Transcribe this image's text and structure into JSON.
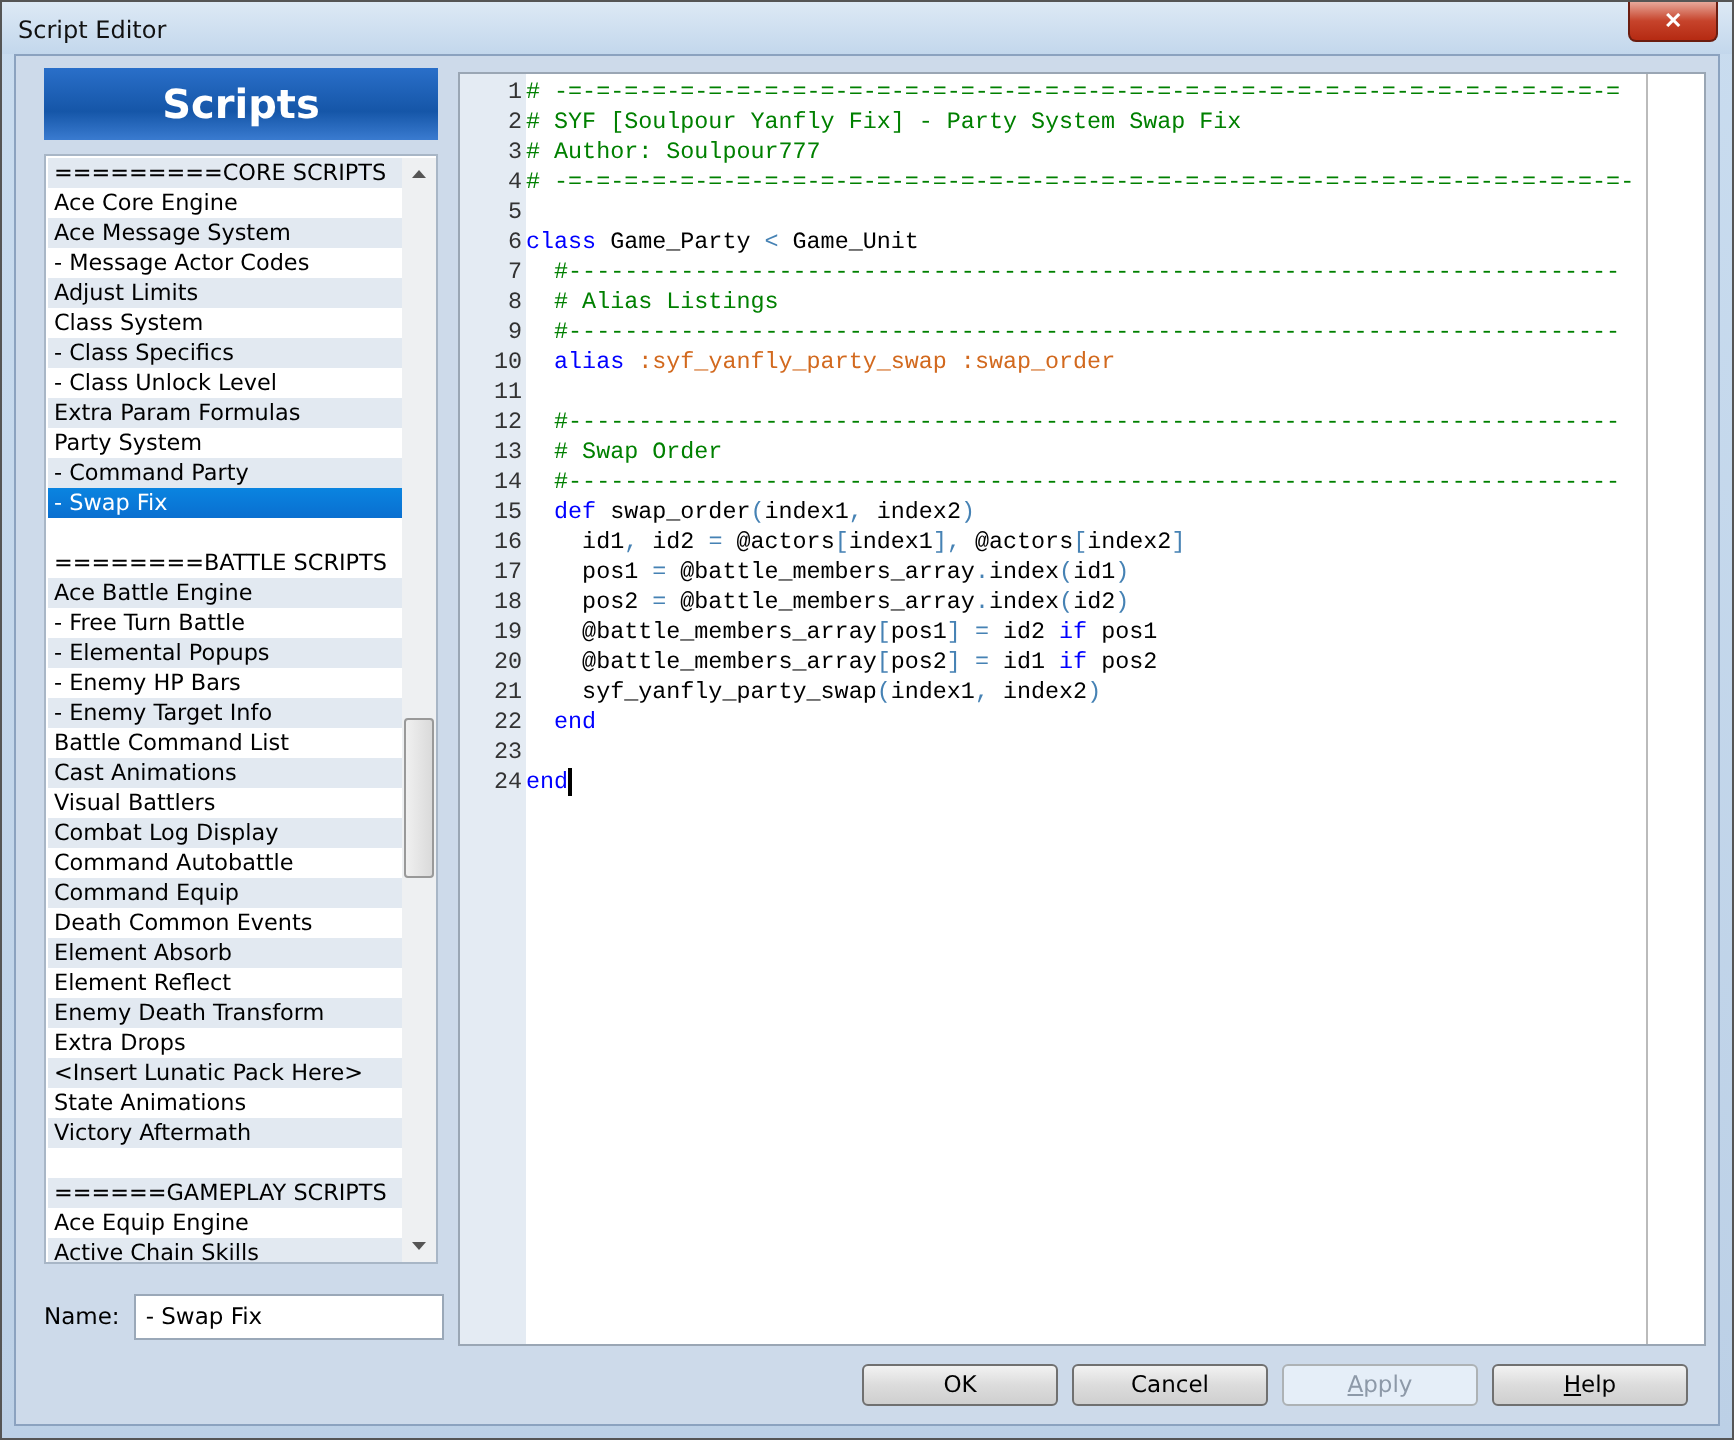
{
  "window": {
    "title": "Script Editor",
    "close_label": "✕"
  },
  "sidebar": {
    "title": "Scripts",
    "items": [
      {
        "kind": "item",
        "label": "=========CORE SCRIPTS",
        "selected": false
      },
      {
        "kind": "item",
        "label": "Ace Core Engine",
        "selected": false
      },
      {
        "kind": "item",
        "label": "Ace Message System",
        "selected": false
      },
      {
        "kind": "item",
        "label": "- Message Actor Codes",
        "selected": false
      },
      {
        "kind": "item",
        "label": "Adjust Limits",
        "selected": false
      },
      {
        "kind": "item",
        "label": "Class System",
        "selected": false
      },
      {
        "kind": "item",
        "label": "- Class Specifics",
        "selected": false
      },
      {
        "kind": "item",
        "label": "- Class Unlock Level",
        "selected": false
      },
      {
        "kind": "item",
        "label": "Extra Param Formulas",
        "selected": false
      },
      {
        "kind": "item",
        "label": "Party System",
        "selected": false
      },
      {
        "kind": "item",
        "label": "- Command Party",
        "selected": false
      },
      {
        "kind": "item",
        "label": "- Swap Fix",
        "selected": true
      },
      {
        "kind": "blank",
        "selected": false
      },
      {
        "kind": "item",
        "label": "========BATTLE SCRIPTS",
        "selected": false
      },
      {
        "kind": "item",
        "label": "Ace Battle Engine",
        "selected": false
      },
      {
        "kind": "item",
        "label": "- Free Turn Battle",
        "selected": false
      },
      {
        "kind": "item",
        "label": "- Elemental Popups",
        "selected": false
      },
      {
        "kind": "item",
        "label": "- Enemy HP Bars",
        "selected": false
      },
      {
        "kind": "item",
        "label": "- Enemy Target Info",
        "selected": false
      },
      {
        "kind": "item",
        "label": "Battle Command List",
        "selected": false
      },
      {
        "kind": "item",
        "label": "Cast Animations",
        "selected": false
      },
      {
        "kind": "item",
        "label": "Visual Battlers",
        "selected": false
      },
      {
        "kind": "item",
        "label": "Combat Log Display",
        "selected": false
      },
      {
        "kind": "item",
        "label": "Command Autobattle",
        "selected": false
      },
      {
        "kind": "item",
        "label": "Command Equip",
        "selected": false
      },
      {
        "kind": "item",
        "label": "Death Common Events",
        "selected": false
      },
      {
        "kind": "item",
        "label": "Element Absorb",
        "selected": false
      },
      {
        "kind": "item",
        "label": "Element Reflect",
        "selected": false
      },
      {
        "kind": "item",
        "label": "Enemy Death Transform",
        "selected": false
      },
      {
        "kind": "item",
        "label": "Extra Drops",
        "selected": false
      },
      {
        "kind": "item",
        "label": "<Insert Lunatic Pack Here>",
        "selected": false
      },
      {
        "kind": "item",
        "label": "State Animations",
        "selected": false
      },
      {
        "kind": "item",
        "label": "Victory Aftermath",
        "selected": false
      },
      {
        "kind": "blank",
        "selected": false
      },
      {
        "kind": "item",
        "label": "======GAMEPLAY SCRIPTS",
        "selected": false
      },
      {
        "kind": "item",
        "label": "Ace Equip Engine",
        "selected": false
      },
      {
        "kind": "item",
        "label": "Active Chain Skills",
        "selected": false
      }
    ]
  },
  "name_field": {
    "label": "Name:",
    "value": "- Swap Fix"
  },
  "editor": {
    "lines": [
      {
        "number": "1",
        "tokens": [
          {
            "kind": "comment",
            "text": "# -=-=-=-=-=-=-=-=-=-=-=-=-=-=-=-=-=-=-=-=-=-=-=-=-=-=-=-=-=-=-=-=-=-=-=-=-=-="
          }
        ]
      },
      {
        "number": "2",
        "tokens": [
          {
            "kind": "comment",
            "text": "# SYF [Soulpour Yanfly Fix] - Party System Swap Fix"
          }
        ]
      },
      {
        "number": "3",
        "tokens": [
          {
            "kind": "comment",
            "text": "# Author: Soulpour777"
          }
        ]
      },
      {
        "number": "4",
        "tokens": [
          {
            "kind": "comment",
            "text": "# -=-=-=-=-=-=-=-=-=-=-=-=-=-=-=-=-=-=-=-=-=-=-=-=-=-=-=-=-=-=-=-=-=-=-=-=-=-=-"
          }
        ]
      },
      {
        "number": "5"
      },
      {
        "number": "6",
        "tokens": [
          {
            "kind": "keyword",
            "text": "class"
          },
          {
            "kind": "plain",
            "text": " Game_Party "
          },
          {
            "kind": "punct",
            "text": "<"
          },
          {
            "kind": "plain",
            "text": " Game_Unit"
          }
        ]
      },
      {
        "number": "7",
        "tokens": [
          {
            "kind": "comment",
            "text": "  #---------------------------------------------------------------------------"
          }
        ]
      },
      {
        "number": "8",
        "tokens": [
          {
            "kind": "comment",
            "text": "  # Alias Listings"
          }
        ]
      },
      {
        "number": "9",
        "tokens": [
          {
            "kind": "comment",
            "text": "  #---------------------------------------------------------------------------"
          }
        ]
      },
      {
        "number": "10",
        "tokens": [
          {
            "kind": "keyword",
            "text": "  alias"
          },
          {
            "kind": "symbol",
            "text": " :syf_yanfly_party_swap :swap_order"
          }
        ]
      },
      {
        "number": "11"
      },
      {
        "number": "12",
        "tokens": [
          {
            "kind": "comment",
            "text": "  #---------------------------------------------------------------------------"
          }
        ]
      },
      {
        "number": "13",
        "tokens": [
          {
            "kind": "comment",
            "text": "  # Swap Order"
          }
        ]
      },
      {
        "number": "14",
        "tokens": [
          {
            "kind": "comment",
            "text": "  #---------------------------------------------------------------------------"
          }
        ]
      },
      {
        "number": "15",
        "tokens": [
          {
            "kind": "keyword",
            "text": "  def"
          },
          {
            "kind": "plain",
            "text": " swap_order"
          },
          {
            "kind": "punct",
            "text": "("
          },
          {
            "kind": "plain",
            "text": "index1"
          },
          {
            "kind": "punct",
            "text": ", "
          },
          {
            "kind": "plain",
            "text": "index2"
          },
          {
            "kind": "punct",
            "text": ")"
          }
        ]
      },
      {
        "number": "16",
        "tokens": [
          {
            "kind": "plain",
            "text": "    id1"
          },
          {
            "kind": "punct",
            "text": ", "
          },
          {
            "kind": "plain",
            "text": "id2 "
          },
          {
            "kind": "punct",
            "text": "="
          },
          {
            "kind": "plain",
            "text": " @actors"
          },
          {
            "kind": "punct",
            "text": "["
          },
          {
            "kind": "plain",
            "text": "index1"
          },
          {
            "kind": "punct",
            "text": "], "
          },
          {
            "kind": "plain",
            "text": "@actors"
          },
          {
            "kind": "punct",
            "text": "["
          },
          {
            "kind": "plain",
            "text": "index2"
          },
          {
            "kind": "punct",
            "text": "]"
          }
        ]
      },
      {
        "number": "17",
        "tokens": [
          {
            "kind": "plain",
            "text": "    pos1 "
          },
          {
            "kind": "punct",
            "text": "="
          },
          {
            "kind": "plain",
            "text": " @battle_members_array"
          },
          {
            "kind": "punct",
            "text": "."
          },
          {
            "kind": "plain",
            "text": "index"
          },
          {
            "kind": "punct",
            "text": "("
          },
          {
            "kind": "plain",
            "text": "id1"
          },
          {
            "kind": "punct",
            "text": ")"
          }
        ]
      },
      {
        "number": "18",
        "tokens": [
          {
            "kind": "plain",
            "text": "    pos2 "
          },
          {
            "kind": "punct",
            "text": "="
          },
          {
            "kind": "plain",
            "text": " @battle_members_array"
          },
          {
            "kind": "punct",
            "text": "."
          },
          {
            "kind": "plain",
            "text": "index"
          },
          {
            "kind": "punct",
            "text": "("
          },
          {
            "kind": "plain",
            "text": "id2"
          },
          {
            "kind": "punct",
            "text": ")"
          }
        ]
      },
      {
        "number": "19",
        "tokens": [
          {
            "kind": "plain",
            "text": "    @battle_members_array"
          },
          {
            "kind": "punct",
            "text": "["
          },
          {
            "kind": "plain",
            "text": "pos1"
          },
          {
            "kind": "punct",
            "text": "] = "
          },
          {
            "kind": "plain",
            "text": "id2 "
          },
          {
            "kind": "keyword",
            "text": "if"
          },
          {
            "kind": "plain",
            "text": " pos1"
          }
        ]
      },
      {
        "number": "20",
        "tokens": [
          {
            "kind": "plain",
            "text": "    @battle_members_array"
          },
          {
            "kind": "punct",
            "text": "["
          },
          {
            "kind": "plain",
            "text": "pos2"
          },
          {
            "kind": "punct",
            "text": "] = "
          },
          {
            "kind": "plain",
            "text": "id1 "
          },
          {
            "kind": "keyword",
            "text": "if"
          },
          {
            "kind": "plain",
            "text": " pos2"
          }
        ]
      },
      {
        "number": "21",
        "tokens": [
          {
            "kind": "plain",
            "text": "    syf_yanfly_party_swap"
          },
          {
            "kind": "punct",
            "text": "("
          },
          {
            "kind": "plain",
            "text": "index1"
          },
          {
            "kind": "punct",
            "text": ", "
          },
          {
            "kind": "plain",
            "text": "index2"
          },
          {
            "kind": "punct",
            "text": ")"
          }
        ]
      },
      {
        "number": "22",
        "tokens": [
          {
            "kind": "keyword",
            "text": "  end"
          }
        ]
      },
      {
        "number": "23"
      },
      {
        "number": "24",
        "tokens": [
          {
            "kind": "keyword",
            "text": "end"
          }
        ],
        "cursor": true
      }
    ]
  },
  "buttons": [
    {
      "label": "OK",
      "disabled": false,
      "underline_first": false
    },
    {
      "label": "Cancel",
      "disabled": false,
      "underline_first": false
    },
    {
      "label": "Apply",
      "disabled": true,
      "underline_first": true
    },
    {
      "label": "Help",
      "disabled": false,
      "underline_first": true
    }
  ]
}
